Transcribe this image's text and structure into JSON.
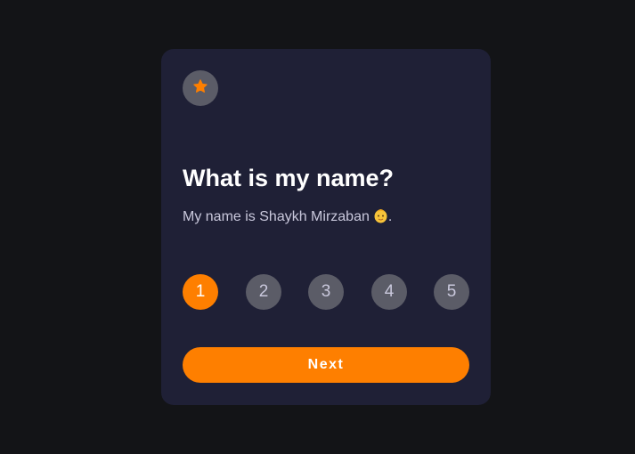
{
  "card": {
    "badge_icon": "star-icon",
    "title": "What is my name?",
    "description": "My name is Shaykh Mirzaban",
    "description_emoji_icon": "baby-emoji-icon",
    "description_end": ".",
    "steps": [
      "1",
      "2",
      "3",
      "4",
      "5"
    ],
    "active_step": "1",
    "next_label": "Next"
  },
  "colors": {
    "background": "#131417",
    "card": "#1f2036",
    "accent": "#fe7f00",
    "inactive": "#5b5c67"
  }
}
